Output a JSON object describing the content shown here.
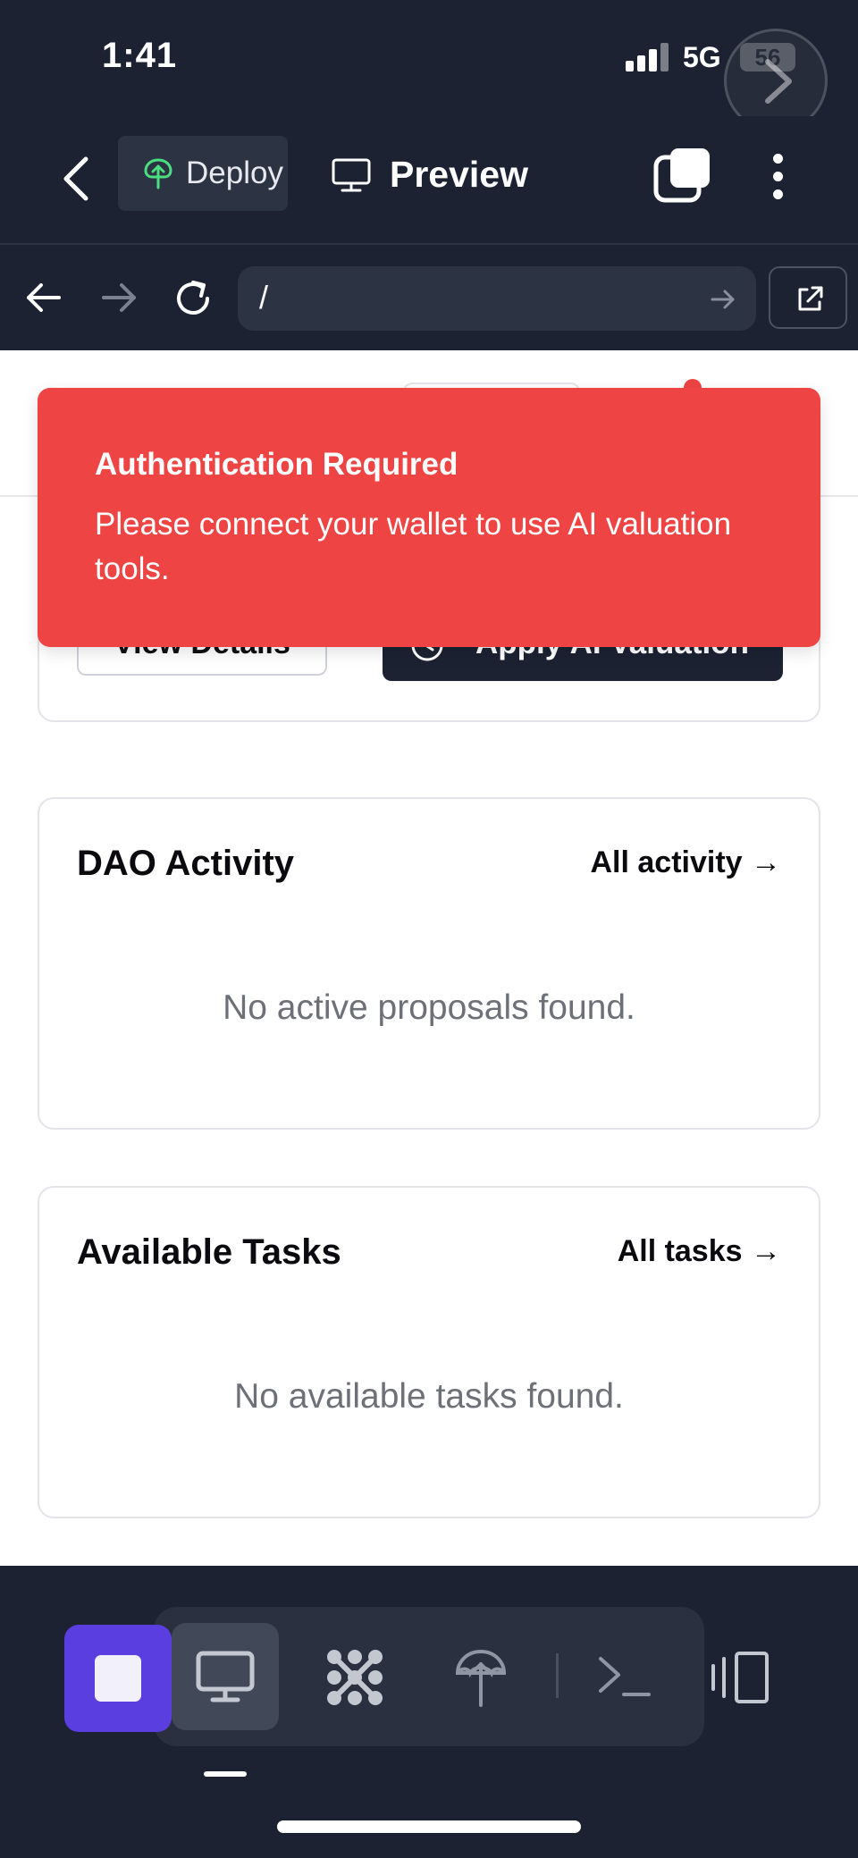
{
  "status_bar": {
    "time": "1:41",
    "network": "5G",
    "battery": "56"
  },
  "toolbar": {
    "deploy_label": "Deploy",
    "preview_label": "Preview"
  },
  "browser": {
    "url": "/"
  },
  "card_top": {
    "view_details_label": "View Details",
    "apply_ai_label": "Apply AI Valuation"
  },
  "toast": {
    "title": "Authentication Required",
    "message": "Please connect your wallet to use AI valuation tools."
  },
  "dao_card": {
    "title": "DAO Activity",
    "link": "All activity →",
    "empty": "No active proposals found."
  },
  "tasks_card": {
    "title": "Available Tasks",
    "link": "All tasks →",
    "empty": "No available tasks found."
  },
  "colors": {
    "chrome_bg": "#1c2232",
    "toast_bg": "#ef4444",
    "stop_accent": "#5b3ee0",
    "deploy_icon": "#4ade80"
  },
  "icons": {
    "float": "chevron-right-icon",
    "back": "chevron-left-icon",
    "deploy": "deploy-tree-icon",
    "preview": "monitor-icon",
    "tabs": "tabs-icon",
    "menu": "more-vertical-icon",
    "nav_back": "arrow-left-icon",
    "nav_forward": "arrow-right-icon",
    "reload": "reload-icon",
    "go": "arrow-right-icon",
    "external": "external-link-icon",
    "apply_ai": "clock-icon",
    "stop": "stop-icon",
    "dock": [
      "monitor-icon",
      "agents-icon",
      "deploy-icon",
      "terminal-icon"
    ],
    "panel": "panel-icon"
  }
}
